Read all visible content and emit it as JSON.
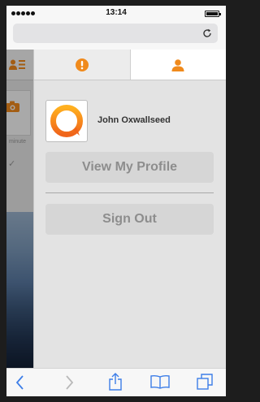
{
  "status_bar": {
    "time": "13:14"
  },
  "menu": {
    "tabs": [
      {
        "icon": "exclamation-icon",
        "active": false
      },
      {
        "icon": "user-icon",
        "active": true
      }
    ],
    "user_name": "John Oxwallseed",
    "buttons": {
      "view_profile": "View My Profile",
      "sign_out": "Sign Out"
    }
  },
  "background_app": {
    "caption": "minute",
    "check": "✓"
  },
  "toolbar": {
    "icons": [
      "back-icon",
      "forward-icon",
      "share-icon",
      "bookmarks-icon",
      "tabs-icon"
    ]
  },
  "colors": {
    "accent": "#f08a1c",
    "panel": "#e3e3e3",
    "button": "#d6d6d6",
    "button_text": "#8d8d8d"
  }
}
